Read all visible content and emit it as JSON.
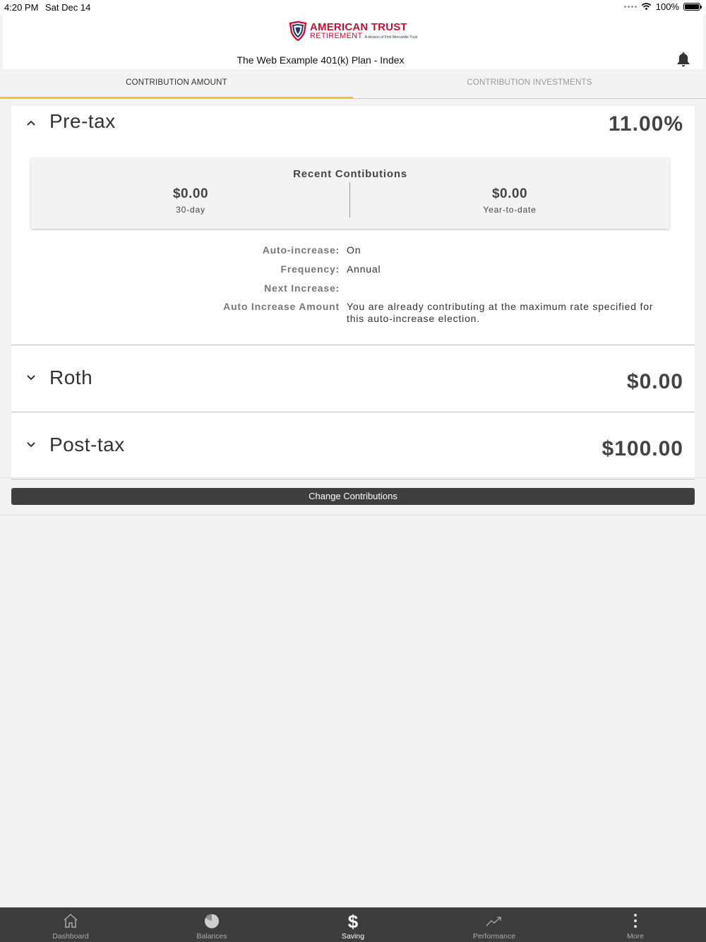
{
  "status_bar": {
    "time": "4:20 PM",
    "date": "Sat Dec 14",
    "battery": "100%"
  },
  "header": {
    "logo_line1": "AMERICAN TRUST",
    "logo_line2": "RETIREMENT",
    "logo_tagline": "A division of First Mercantile Trust",
    "plan_title": "The Web Example 401(k) Plan - Index"
  },
  "tabs": [
    {
      "label": "CONTRIBUTION AMOUNT",
      "active": true
    },
    {
      "label": "CONTRIBUTION INVESTMENTS",
      "active": false
    }
  ],
  "pretax": {
    "name": "Pre-tax",
    "value": "11.00%",
    "recent_title": "Recent Contibutions",
    "thirty_day_amount": "$0.00",
    "thirty_day_label": "30-day",
    "ytd_amount": "$0.00",
    "ytd_label": "Year-to-date",
    "details": [
      {
        "label": "Auto-increase:",
        "value": "On"
      },
      {
        "label": "Frequency:",
        "value": "Annual"
      },
      {
        "label": "Next Increase:",
        "value": ""
      },
      {
        "label": "Auto Increase Amount",
        "value": "You are already contributing at the maximum rate specified for this auto-increase election."
      }
    ]
  },
  "roth": {
    "name": "Roth",
    "value": "$0.00"
  },
  "posttax": {
    "name": "Post-tax",
    "value": "$100.00"
  },
  "change_button": "Change Contributions",
  "bottom_nav": [
    {
      "label": "Dashboard",
      "icon": "home-icon"
    },
    {
      "label": "Balances",
      "icon": "pie-chart-icon"
    },
    {
      "label": "Saving",
      "icon": "dollar-icon",
      "active": true
    },
    {
      "label": "Performance",
      "icon": "trending-up-icon"
    },
    {
      "label": "More",
      "icon": "more-vertical-icon"
    }
  ],
  "colors": {
    "accent": "#f5c22b",
    "brand_red": "#c8102e",
    "brand_blue": "#1f3a6d",
    "nav_bg": "#3d3d3d"
  }
}
